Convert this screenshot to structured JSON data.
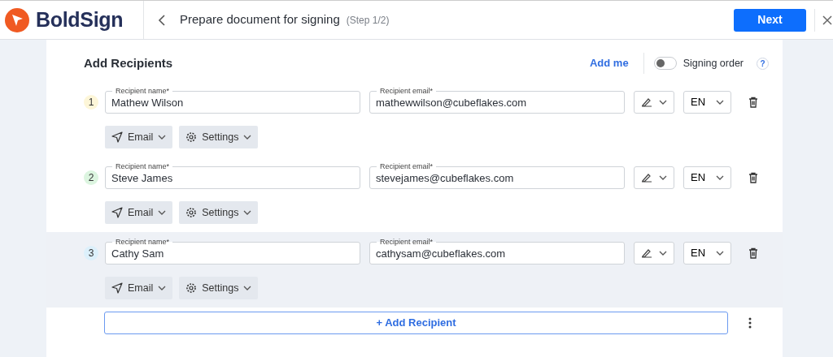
{
  "header": {
    "brand": "BoldSign",
    "title": "Prepare document for signing",
    "step": "(Step 1/2)",
    "next_button": "Next"
  },
  "section": {
    "title": "Add Recipients",
    "add_me": "Add me",
    "signing_order": {
      "label": "Signing order",
      "on": false,
      "help": "?"
    }
  },
  "recipients": [
    {
      "number": "1",
      "color": "#fdf6d8",
      "highlighted": false,
      "name_label": "Recipient name*",
      "name": "Mathew Wilson",
      "email_label": "Recipient email*",
      "email": "mathewwilson@cubeflakes.com",
      "language": "EN",
      "delivery": "Email",
      "settings": "Settings"
    },
    {
      "number": "2",
      "color": "#dcf5e0",
      "highlighted": false,
      "name_label": "Recipient name*",
      "name": "Steve James",
      "email_label": "Recipient email*",
      "email": "stevejames@cubeflakes.com",
      "language": "EN",
      "delivery": "Email",
      "settings": "Settings"
    },
    {
      "number": "3",
      "color": "#dcf0fb",
      "highlighted": true,
      "name_label": "Recipient name*",
      "name": "Cathy Sam",
      "email_label": "Recipient email*",
      "email": "cathysam@cubeflakes.com",
      "language": "EN",
      "delivery": "Email",
      "settings": "Settings"
    }
  ],
  "add_recipient": "+ Add Recipient"
}
